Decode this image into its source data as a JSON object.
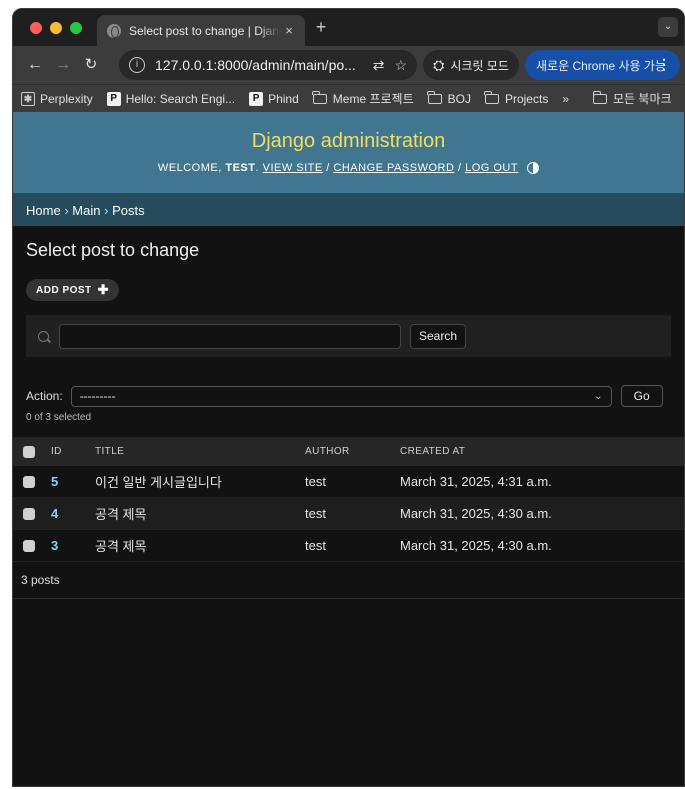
{
  "browser": {
    "tab_title": "Select post to change | Django site admin",
    "tab_close": "×",
    "new_tab": "+",
    "tab_menu": "⌄",
    "url": "127.0.0.1:8000/admin/main/po...",
    "incognito_label": "시크릿 모드",
    "update_label": "새로운 Chrome 사용 가능",
    "menu_dots": "⋮",
    "bookmarks": [
      {
        "label": "Perplexity",
        "icon": "perplexity-icon"
      },
      {
        "label": "Hello: Search Engi...",
        "icon": "phind-icon"
      },
      {
        "label": "Phind",
        "icon": "phind-icon"
      },
      {
        "label": "Meme 프로젝트",
        "icon": "folder-icon"
      },
      {
        "label": "BOJ",
        "icon": "folder-icon"
      },
      {
        "label": "Projects",
        "icon": "folder-icon"
      }
    ],
    "bookmarks_overflow": "»",
    "all_bookmarks": "모든 북마크"
  },
  "admin": {
    "site_name": "Django administration",
    "welcome": "WELCOME,",
    "username": "TEST",
    "view_site": "VIEW SITE",
    "change_password": "CHANGE PASSWORD",
    "log_out": "LOG OUT",
    "breadcrumbs": {
      "home": "Home",
      "app": "Main",
      "model": "Posts",
      "sep": "›"
    },
    "page_title": "Select post to change",
    "add_button": "ADD POST",
    "search_button": "Search",
    "search_placeholder": "",
    "action_label": "Action:",
    "action_value": "---------",
    "go_button": "Go",
    "selected_count": "0 of 3 selected",
    "columns": {
      "id": "ID",
      "title": "TITLE",
      "author": "AUTHOR",
      "created": "CREATED AT"
    },
    "rows": [
      {
        "id": "5",
        "title": "이건 일반 게시글입니다",
        "author": "test",
        "created": "March 31, 2025, 4:31 a.m."
      },
      {
        "id": "4",
        "title": "공격 제목",
        "author": "test",
        "created": "March 31, 2025, 4:30 a.m."
      },
      {
        "id": "3",
        "title": "공격 제목",
        "author": "test",
        "created": "March 31, 2025, 4:30 a.m."
      }
    ],
    "paginator": "3 posts"
  },
  "colors": {
    "header_bg": "#417690",
    "branding": "#f5dd5d",
    "breadcrumbs_bg": "#264b5d",
    "link": "#81d4fa",
    "update_pill": "#174ea6"
  }
}
